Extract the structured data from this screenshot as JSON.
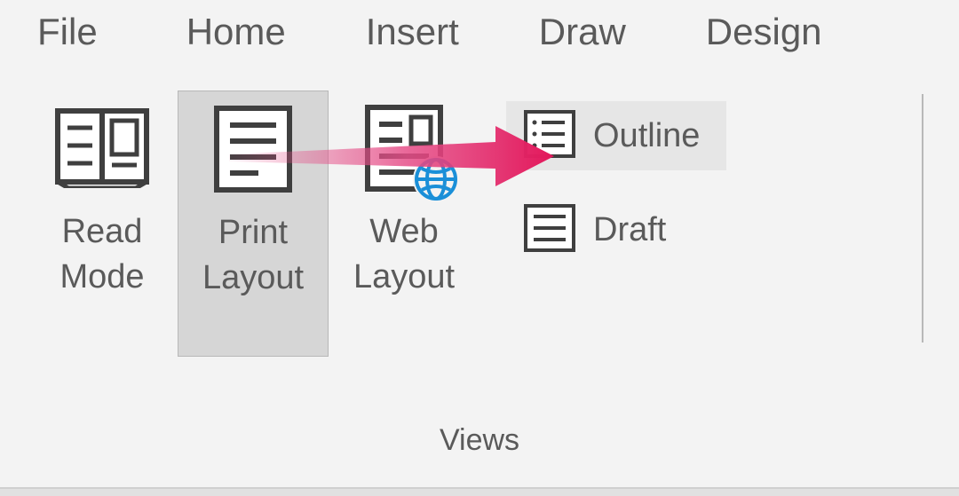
{
  "tabs": {
    "file": "File",
    "home": "Home",
    "insert": "Insert",
    "draw": "Draw",
    "design": "Design"
  },
  "ribbon": {
    "views_group_label": "Views",
    "read_mode": "Read\nMode",
    "print_layout": "Print\nLayout",
    "web_layout": "Web\nLayout",
    "outline": "Outline",
    "draft": "Draft"
  }
}
